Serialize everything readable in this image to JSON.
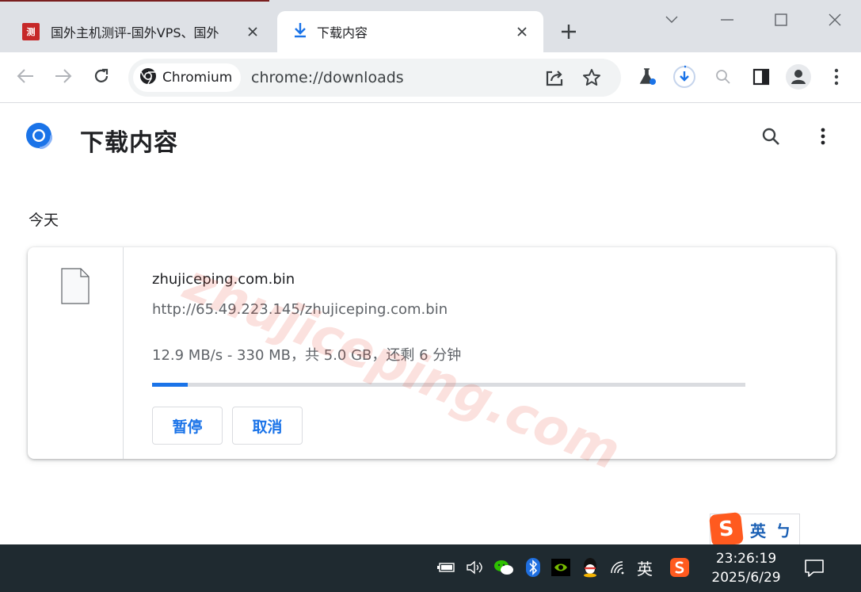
{
  "browser": {
    "tabs": [
      {
        "title": "国外主机测评-国外VPS、国外",
        "favicon": "site-logo-icon",
        "active": false
      },
      {
        "title": "下载内容",
        "favicon": "download-icon",
        "active": true
      }
    ],
    "window_controls": [
      "minimize-icon",
      "maximize-icon",
      "close-icon"
    ],
    "omnibox": {
      "chip_label": "Chromium",
      "url": "chrome://downloads"
    }
  },
  "page": {
    "title": "下载内容",
    "section_label": "今天",
    "accent": "#1a73e8"
  },
  "download": {
    "filename": "zhujiceping.com.bin",
    "url": "http://65.49.223.145/zhujiceping.com.bin",
    "status": "12.9 MB/s - 330 MB，共 5.0 GB，还剩 6 分钟",
    "progress_fraction": 0.06,
    "pause_label": "暂停",
    "cancel_label": "取消"
  },
  "watermark": "zhujiceping.com",
  "ime": {
    "logo": "S",
    "lang": "英",
    "mode": "ㄅ"
  },
  "taskbar": {
    "ime_lang": "英",
    "time": "23:26:19",
    "date": "2025/6/29"
  }
}
